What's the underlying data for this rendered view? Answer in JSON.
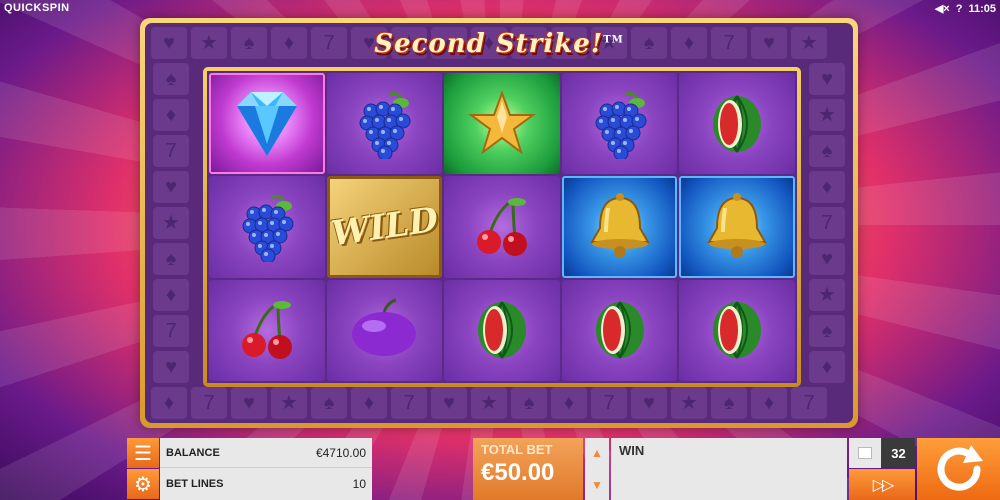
{
  "brand": "QUICKSPIN",
  "status": {
    "sound_icon": "speaker-muted-icon",
    "help": "?",
    "time": "11:05"
  },
  "game": {
    "title": "Second Strike!",
    "trademark": "TM"
  },
  "reels": [
    [
      "diamond",
      "grapes",
      "cherries"
    ],
    [
      "grapes",
      "wild",
      "plum"
    ],
    [
      "star",
      "cherries",
      "watermelon"
    ],
    [
      "grapes",
      "bell",
      "watermelon"
    ],
    [
      "watermelon",
      "bell",
      "watermelon"
    ]
  ],
  "wild_label": "WILD",
  "bottom": {
    "balance_label": "BALANCE",
    "balance_value": "€4710.00",
    "betlines_label": "BET LINES",
    "betlines_value": "10",
    "totalbet_label": "TOTAL BET",
    "totalbet_value": "€50.00",
    "win_label": "WIN",
    "autospin_count": "32"
  },
  "colors": {
    "accent_orange": "#ee6a12",
    "frame_gold": "#d89a2a",
    "reel_purple": "#8a44c0"
  }
}
